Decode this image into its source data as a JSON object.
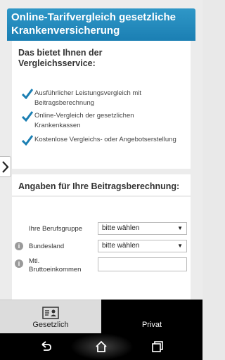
{
  "header": {
    "title": "Online-Tarifvergleich gesetzliche Krankenversicherung"
  },
  "benefits": {
    "heading": "Das bietet Ihnen der Vergleichsservice:",
    "items": [
      {
        "text": "Ausführlicher Leistungsvergleich mit Beitragsberechnung"
      },
      {
        "text": "Online-Vergleich der gesetzlichen Krankenkassen"
      },
      {
        "text": "Kostenlose Vergleichs- oder Angebotserstellung"
      }
    ],
    "check_color": "#1b7fb3"
  },
  "form": {
    "heading": "Angaben für Ihre Beitragsberechnung:",
    "berufsgruppe": {
      "label": "Ihre Berufsgruppe",
      "value": "bitte wählen"
    },
    "bundesland": {
      "label": "Bundesland",
      "value": "bitte wählen"
    },
    "einkommen": {
      "label_line1": "Mtl.",
      "label_line2": "Bruttoeinkommen",
      "value": ""
    }
  },
  "tabs": {
    "gesetzlich": {
      "label": "Gesetzlich",
      "icon": "id-card-icon"
    },
    "privat": {
      "label": "Privat"
    }
  },
  "navbar": {
    "back": "back-icon",
    "home": "home-icon",
    "recents": "recents-icon"
  },
  "colors": {
    "header_blue": "#1b7fb3",
    "privat_bg": "#000000"
  }
}
